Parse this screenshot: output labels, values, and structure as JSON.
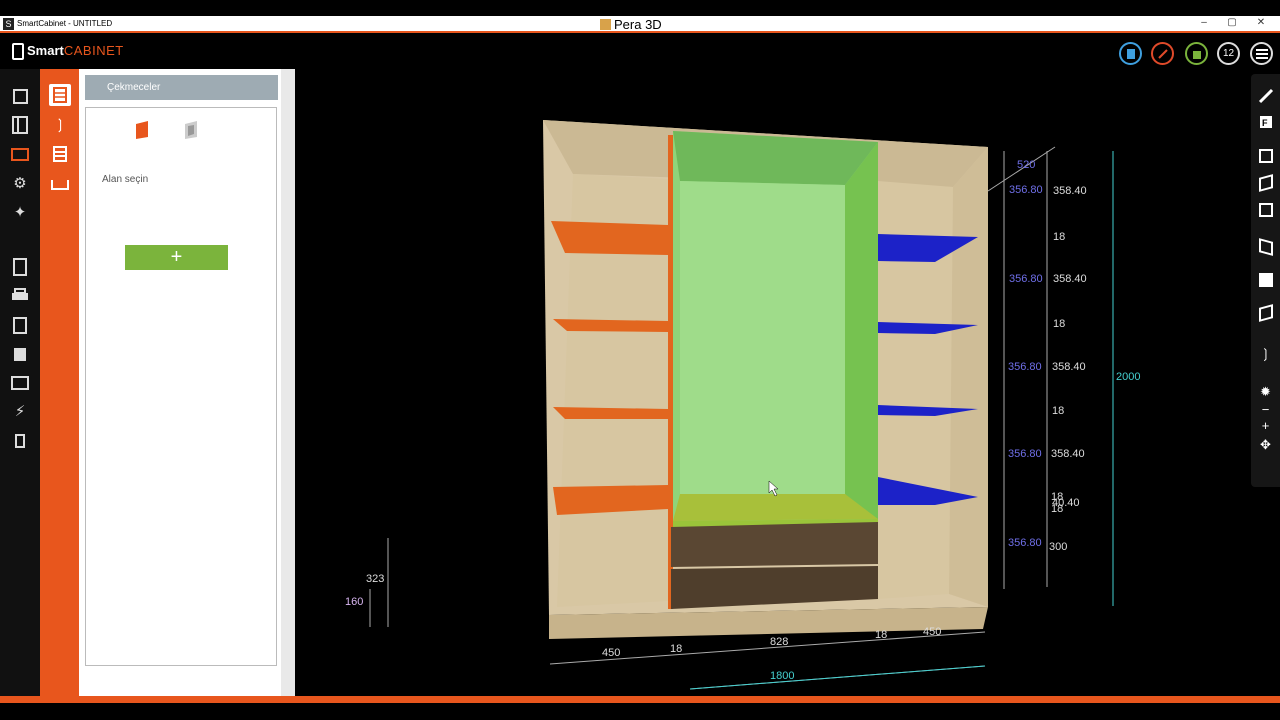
{
  "window": {
    "app_title": "SmartCabinet - UNTITLED",
    "center_title": "Pera 3D",
    "app_icon": "S",
    "controls": [
      "–",
      "▢",
      "✕"
    ]
  },
  "header": {
    "logo_smart": "Smart",
    "logo_cabinet": "CABINET",
    "buttons": [
      {
        "icon": "document-icon",
        "color": "#3fa0e0"
      },
      {
        "icon": "ruler-pencil-icon",
        "color": "#e04a2a"
      },
      {
        "icon": "paint-bucket-icon",
        "color": "#7bb43c"
      },
      {
        "icon": "calendar-icon",
        "label": "12"
      },
      {
        "icon": "menu-icon"
      }
    ]
  },
  "panel": {
    "title": "Çekmeceler",
    "select_area": "Alan seçin",
    "add_label": "+"
  },
  "dimensions": {
    "left_heights": [
      "323",
      "160"
    ],
    "right_blue": [
      "520",
      "356.80",
      "356.80",
      "356.80",
      "356.80",
      "356.80"
    ],
    "right_values": [
      "358.40",
      "18",
      "358.40",
      "18",
      "358.40",
      "18",
      "358.40",
      "18",
      "18",
      "40.40",
      "300"
    ],
    "total_height": "2000",
    "widths": [
      "450",
      "18",
      "828",
      "18",
      "450"
    ],
    "total_width": "1800"
  },
  "colors": {
    "accent": "#e8561d",
    "panel_header": "#9eabb3",
    "add_button": "#7bb43c",
    "wood": "#d9c8a6",
    "shelf_left": "#e2661f",
    "shelf_right": "#1c22c8",
    "selected_compartment": "#8fd47a",
    "drawer": "#5a4733"
  }
}
